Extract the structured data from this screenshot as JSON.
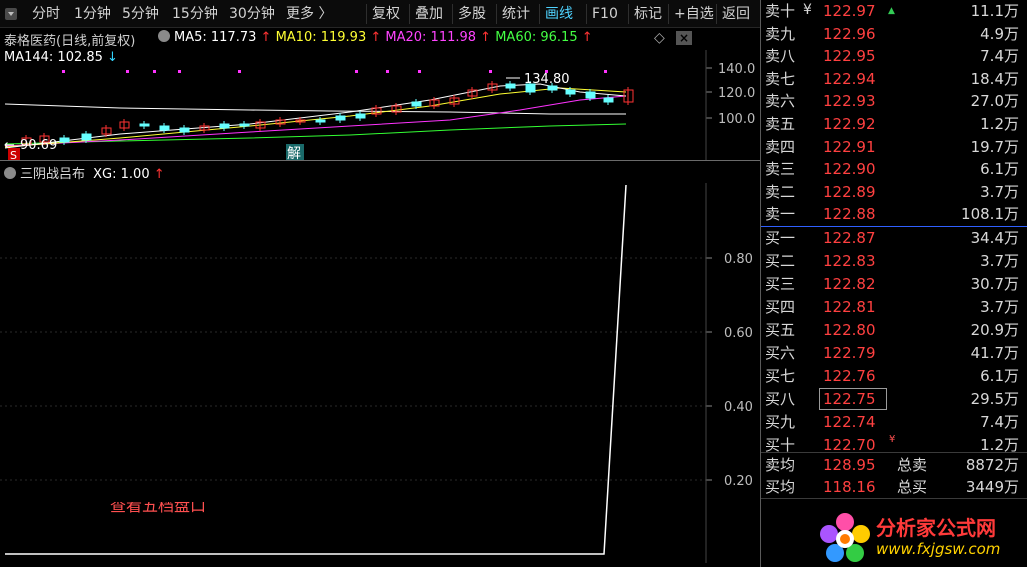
{
  "toolbar": {
    "left": [
      {
        "label": "分时"
      },
      {
        "label": "1分钟"
      },
      {
        "label": "5分钟"
      },
      {
        "label": "15分钟"
      },
      {
        "label": "30分钟"
      },
      {
        "label": "更多 〉"
      }
    ],
    "right": [
      {
        "label": "复权"
      },
      {
        "label": "叠加"
      },
      {
        "label": "多股"
      },
      {
        "label": "统计"
      },
      {
        "label": "画线",
        "active": true
      },
      {
        "label": "F10"
      },
      {
        "label": "标记"
      },
      {
        "label": "+自选"
      },
      {
        "label": "返回"
      }
    ]
  },
  "main": {
    "title": "泰格医药(日线,前复权)",
    "ma5": "MA5: 117.73",
    "ma10": "MA10: 119.93",
    "ma20": "MA20: 111.98",
    "ma60": "MA60: 96.15",
    "ma144": "MA144: 102.85",
    "high_label": "134.80",
    "low_label": "90.69",
    "jie_mark": "解",
    "s_mark": "S",
    "axis": [
      "140.0",
      "120.0",
      "100.0"
    ],
    "colors": {
      "ma5": "#ffffff",
      "ma10": "#ffff00",
      "ma20": "#ff33ff",
      "ma60": "#33ff33",
      "ma144": "#ffffff"
    }
  },
  "sub": {
    "title": "三阴战吕布",
    "xg": "XG: 1.00",
    "axis": [
      "0.80",
      "0.60",
      "0.40",
      "0.20"
    ]
  },
  "orderbook": {
    "sell": [
      {
        "label": "卖十",
        "price": "122.97",
        "vol": "11.1万"
      },
      {
        "label": "卖九",
        "price": "122.96",
        "vol": "4.9万"
      },
      {
        "label": "卖八",
        "price": "122.95",
        "vol": "7.4万"
      },
      {
        "label": "卖七",
        "price": "122.94",
        "vol": "18.4万"
      },
      {
        "label": "卖六",
        "price": "122.93",
        "vol": "27.0万"
      },
      {
        "label": "卖五",
        "price": "122.92",
        "vol": "1.2万"
      },
      {
        "label": "卖四",
        "price": "122.91",
        "vol": "19.7万"
      },
      {
        "label": "卖三",
        "price": "122.90",
        "vol": "6.1万"
      },
      {
        "label": "卖二",
        "price": "122.89",
        "vol": "3.7万"
      },
      {
        "label": "卖一",
        "price": "122.88",
        "vol": "108.1万"
      }
    ],
    "buy": [
      {
        "label": "买一",
        "price": "122.87",
        "vol": "34.4万"
      },
      {
        "label": "买二",
        "price": "122.83",
        "vol": "3.7万"
      },
      {
        "label": "买三",
        "price": "122.82",
        "vol": "30.7万"
      },
      {
        "label": "买四",
        "price": "122.81",
        "vol": "3.7万"
      },
      {
        "label": "买五",
        "price": "122.80",
        "vol": "20.9万"
      },
      {
        "label": "买六",
        "price": "122.79",
        "vol": "41.7万"
      },
      {
        "label": "买七",
        "price": "122.76",
        "vol": "6.1万"
      },
      {
        "label": "买八",
        "price": "122.75",
        "vol": "29.5万"
      },
      {
        "label": "买九",
        "price": "122.74",
        "vol": "7.4万"
      },
      {
        "label": "买十",
        "price": "122.70",
        "vol": "1.2万"
      }
    ],
    "sell_flag": "¥",
    "buy_flag": "¥",
    "avg_sell_label": "卖均",
    "avg_sell_price": "128.95",
    "total_sell_label": "总卖",
    "total_sell": "8872万",
    "avg_buy_label": "买均",
    "avg_buy_price": "118.16",
    "total_buy_label": "总买",
    "total_buy": "3449万"
  },
  "watermark": {
    "name": "分析家公式网",
    "url": "www.fxjgsw.com",
    "partial": "查看五档盘口"
  }
}
